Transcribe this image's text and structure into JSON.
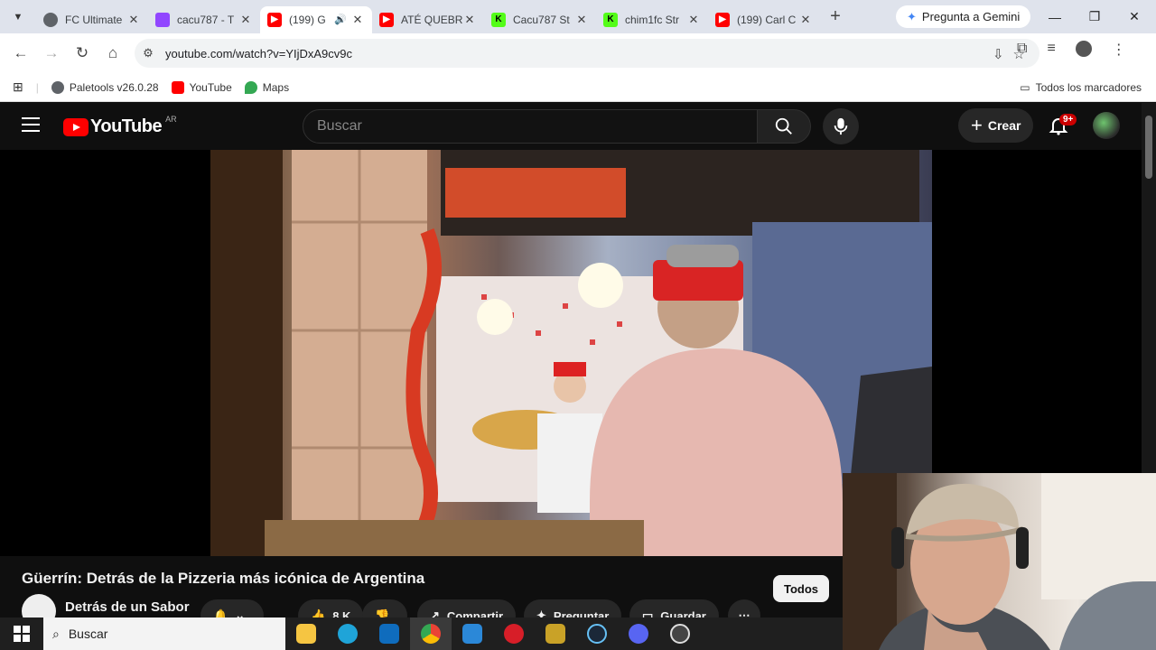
{
  "browser": {
    "tabs": [
      {
        "title": "FC Ultimate",
        "favicon": "globe-icon",
        "color": "#5f6368"
      },
      {
        "title": "cacu787 - T",
        "favicon": "twitch-icon",
        "color": "#9146ff"
      },
      {
        "title": "(199) G",
        "favicon": "youtube-icon",
        "color": "#ff0000",
        "active": true,
        "audio": true
      },
      {
        "title": "ATÉ QUEBR",
        "favicon": "youtube-icon",
        "color": "#ff0000"
      },
      {
        "title": "Cacu787 St",
        "favicon": "kick-icon",
        "color": "#53fc18"
      },
      {
        "title": "chim1fc Str",
        "favicon": "kick-icon",
        "color": "#53fc18"
      },
      {
        "title": "(199) Carl C",
        "favicon": "youtube-icon",
        "color": "#ff0000"
      }
    ],
    "gemini_label": "Pregunta a Gemini",
    "url": "youtube.com/watch?v=YIjDxA9cv9c",
    "bookmarks": [
      {
        "label": "Paletools v26.0.28",
        "icon": "globe-icon"
      },
      {
        "label": "YouTube",
        "icon": "youtube-icon"
      },
      {
        "label": "Maps",
        "icon": "maps-pin-icon"
      }
    ],
    "all_bookmarks_label": "Todos los marcadores"
  },
  "youtube": {
    "logo_text": "YouTube",
    "country_code": "AR",
    "search_placeholder": "Buscar",
    "create_label": "Crear",
    "notifications_badge": "9+",
    "video": {
      "title": "Güerrín: Detrás de la Pizzeria más icónica de Argentina",
      "channel": "Detrás de un Sabor",
      "likes": "8 K",
      "share_label": "Compartir",
      "ask_label": "Preguntar",
      "save_label": "Guardar"
    },
    "filter_chip": "Todos"
  },
  "taskbar": {
    "search_placeholder": "Buscar",
    "apps": [
      "file-explorer-icon",
      "edge-icon",
      "outlook-icon",
      "chrome-icon",
      "store-icon",
      "app-red-icon",
      "app-yellow-icon",
      "steam-icon",
      "discord-icon",
      "app-circle-icon"
    ]
  },
  "colors": {
    "youtube_red": "#ff0000",
    "youtube_bg": "#0f0f0f",
    "chrome_tabstrip": "#dfe3ec"
  }
}
